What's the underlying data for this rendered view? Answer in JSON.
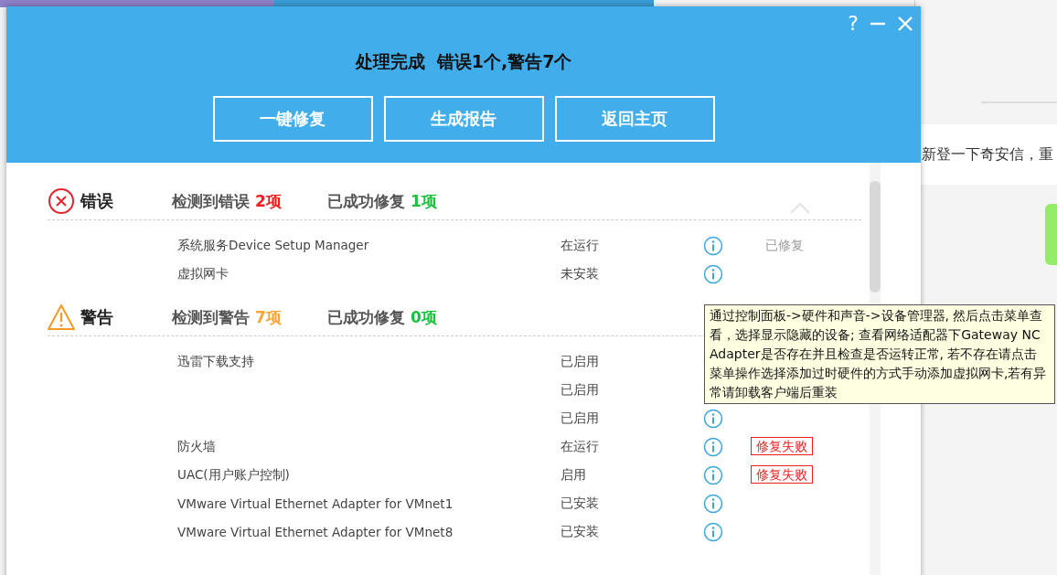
{
  "background": {
    "message": "新登一下奇安信，重"
  },
  "dialog": {
    "title": "处理完成  错误1个,警告7个",
    "controls": [
      "?"
    ],
    "buttons": [
      "一键修复",
      "生成报告",
      "返回主页"
    ],
    "sections": [
      {
        "kind": "error",
        "title": "错误",
        "detected_label": "检测到错误",
        "detected_count": "2项",
        "fixed_label": "已成功修复",
        "fixed_count": "1项",
        "rows": [
          {
            "name": "系统服务Device Setup Manager",
            "status": "在运行",
            "result": {
              "kind": "fixed",
              "text": "已修复"
            }
          },
          {
            "name": "虚拟网卡",
            "status": "未安装"
          }
        ]
      },
      {
        "kind": "warning",
        "title": "警告",
        "detected_label": "检测到警告",
        "detected_count": "7项",
        "fixed_label": "已成功修复",
        "fixed_count": "0项",
        "rows": [
          {
            "name": "迅雷下载支持",
            "status": "已启用"
          },
          {
            "name": "",
            "status": "已启用"
          },
          {
            "name": "",
            "status": "已启用"
          },
          {
            "name": "防火墙",
            "status": "在运行",
            "result": {
              "kind": "failed",
              "text": "修复失败"
            }
          },
          {
            "name": "UAC(用户账户控制)",
            "status": "启用",
            "result": {
              "kind": "failed",
              "text": "修复失败"
            }
          },
          {
            "name": "VMware Virtual Ethernet Adapter for VMnet1",
            "status": "已安装"
          },
          {
            "name": "VMware Virtual Ethernet Adapter for VMnet8",
            "status": "已安装"
          }
        ]
      }
    ],
    "tooltip": "通过控制面板->硬件和声音->设备管理器, 然后点击菜单查看，选择显示隐藏的设备; 查看网络适配器下Gateway NC Adapter是否存在并且检查是否运转正常, 若不存在请点击菜单操作选择添加过时硬件的方式手动添加虚拟网卡,若有异常请卸载客户端后重装"
  }
}
